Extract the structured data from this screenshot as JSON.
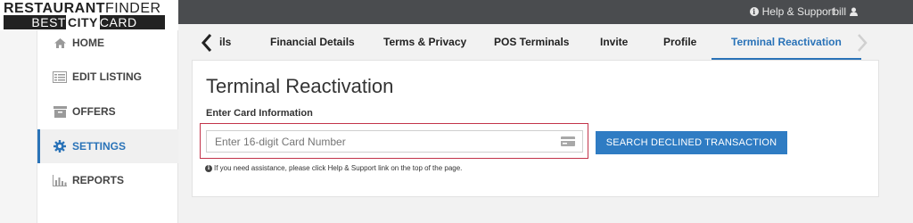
{
  "logo": {
    "line1_bold": "RESTAURANT",
    "line1_rest": "FINDER",
    "line2_pre": "BEST",
    "line2_highlight": "CITY",
    "line2_post": "CARD"
  },
  "topbar": {
    "help_label": "Help & Support",
    "username": "bill"
  },
  "sidebar": {
    "items": [
      {
        "label": "HOME",
        "icon": "home-icon"
      },
      {
        "label": "EDIT LISTING",
        "icon": "listing-icon"
      },
      {
        "label": "OFFERS",
        "icon": "offers-icon"
      },
      {
        "label": "SETTINGS",
        "icon": "gear-icon",
        "active": true
      },
      {
        "label": "REPORTS",
        "icon": "bar-chart-icon"
      }
    ]
  },
  "tabs": [
    {
      "label": "ils"
    },
    {
      "label": "Financial Details"
    },
    {
      "label": "Terms & Privacy"
    },
    {
      "label": "POS Terminals"
    },
    {
      "label": "Invite"
    },
    {
      "label": "Profile"
    },
    {
      "label": "Terminal Reactivation",
      "active": true
    }
  ],
  "main": {
    "title": "Terminal Reactivation",
    "subtitle": "Enter Card Information",
    "card_input": {
      "placeholder": "Enter 16-digit Card Number",
      "value": ""
    },
    "search_button": "SEARCH DECLINED TRANSACTION",
    "help_note": "If you need assistance, please click Help & Support link on the top of the page."
  },
  "colors": {
    "accent": "#2a73b8",
    "button": "#2f7cc3",
    "topbar": "#4a4c4f",
    "highlight_border": "#c2334a"
  }
}
